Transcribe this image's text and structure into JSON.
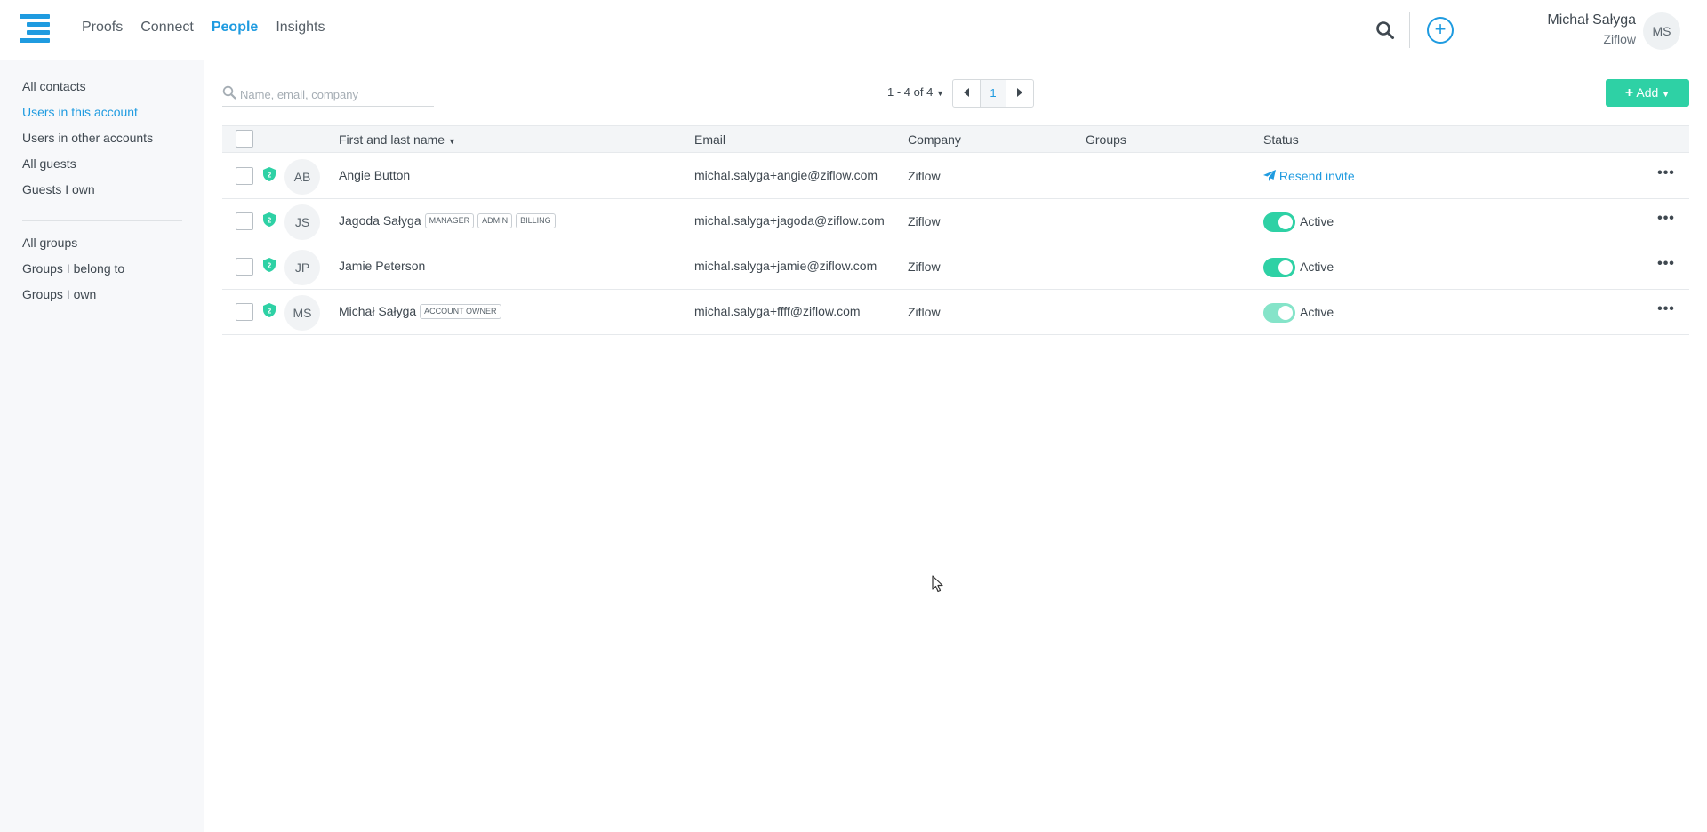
{
  "header": {
    "nav": [
      "Proofs",
      "Connect",
      "People",
      "Insights"
    ],
    "active_nav": "People",
    "user_name": "Michał Sałyga",
    "user_org": "Ziflow",
    "user_initials": "MS",
    "plus_symbol": "+",
    "accent_color": "#1f9be0"
  },
  "sidebar": {
    "contacts": [
      "All contacts",
      "Users in this account",
      "Users in other accounts",
      "All guests",
      "Guests I own"
    ],
    "groups": [
      "All groups",
      "Groups I belong to",
      "Groups I own"
    ],
    "active_item": "Users in this account"
  },
  "toolbar": {
    "search_placeholder": "Name, email, company",
    "pager_text": "1 - 4 of 4",
    "page_number": "1",
    "add_label": "Add",
    "add_color": "#2ed1a5"
  },
  "table": {
    "headers": [
      "First and last name",
      "Email",
      "Company",
      "Groups",
      "Status"
    ],
    "rows": [
      {
        "initials": "AB",
        "name": "Angie Button",
        "tags": [],
        "email": "michal.salyga+angie@ziflow.com",
        "company": "Ziflow",
        "groups": "",
        "status": "Resend invite"
      },
      {
        "initials": "JS",
        "name": "Jagoda Sałyga",
        "tags": [
          "MANAGER",
          "ADMIN",
          "BILLING"
        ],
        "email": "michal.salyga+jagoda@ziflow.com",
        "company": "Ziflow",
        "groups": "",
        "status": "Active"
      },
      {
        "initials": "JP",
        "name": "Jamie Peterson",
        "tags": [],
        "email": "michal.salyga+jamie@ziflow.com",
        "company": "Ziflow",
        "groups": "",
        "status": "Active"
      },
      {
        "initials": "MS",
        "name": "Michał Sałyga",
        "tags": [
          "ACCOUNT OWNER"
        ],
        "email": "michal.salyga+ffff@ziflow.com",
        "company": "Ziflow",
        "groups": "",
        "status": "Active"
      }
    ]
  }
}
